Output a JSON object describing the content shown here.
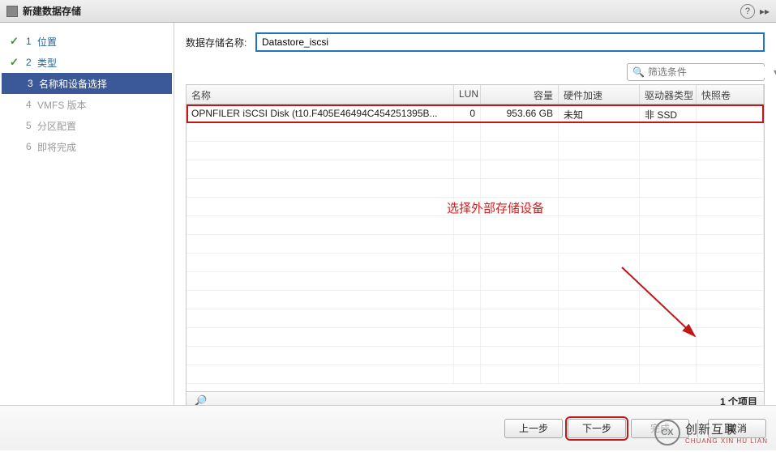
{
  "titlebar": {
    "title": "新建数据存储"
  },
  "steps": [
    {
      "num": "1",
      "label": "位置",
      "state": "done"
    },
    {
      "num": "2",
      "label": "类型",
      "state": "done"
    },
    {
      "num": "3",
      "label": "名称和设备选择",
      "state": "current"
    },
    {
      "num": "4",
      "label": "VMFS 版本",
      "state": "future"
    },
    {
      "num": "5",
      "label": "分区配置",
      "state": "future"
    },
    {
      "num": "6",
      "label": "即将完成",
      "state": "future"
    }
  ],
  "name_field": {
    "label": "数据存储名称:",
    "value": "Datastore_iscsi"
  },
  "filter": {
    "placeholder": "筛选条件"
  },
  "grid": {
    "headers": {
      "name": "名称",
      "lun": "LUN",
      "cap": "容量",
      "hw": "硬件加速",
      "drv": "驱动器类型",
      "snap": "快照卷"
    },
    "rows": [
      {
        "name": "OPNFILER iSCSI Disk (t10.F405E46494C454251395B...",
        "lun": "0",
        "cap": "953.66 GB",
        "hw": "未知",
        "drv": "非 SSD",
        "snap": ""
      }
    ],
    "footer_count": "1 个项目"
  },
  "annotation": "选择外部存储设备",
  "buttons": {
    "prev": "上一步",
    "next": "下一步",
    "finish": "完成",
    "cancel": "取消"
  },
  "logo": {
    "text1": "创新互联",
    "text2": "CHUANG XIN HU LIAN",
    "inner": "CX"
  }
}
